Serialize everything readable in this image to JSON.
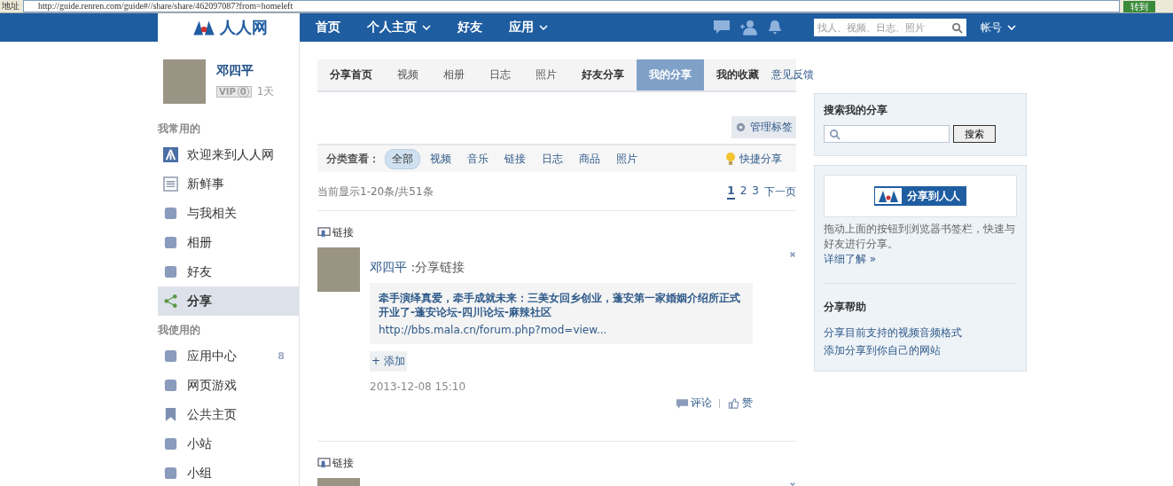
{
  "address_bar": {
    "label": "地址",
    "url": "http://guide.renren.com/guide#//share/share/462097087?from=homeleft",
    "go_label": "转到"
  },
  "nav": {
    "logo_text": "人人网",
    "items": [
      {
        "label": "首页",
        "has_menu": false
      },
      {
        "label": "个人主页",
        "has_menu": true
      },
      {
        "label": "好友",
        "has_menu": false
      },
      {
        "label": "应用",
        "has_menu": true
      }
    ],
    "search_placeholder": "找人、视频、日志、照片",
    "account_label": "帐号"
  },
  "profile": {
    "name": "邓四平",
    "vip": "VIP",
    "vip_level": "0",
    "days": "1天"
  },
  "sidebar": {
    "sections": [
      {
        "title": "我常用的",
        "items": [
          {
            "label": "欢迎来到人人网",
            "selected": false
          },
          {
            "label": "新鲜事",
            "selected": false
          },
          {
            "label": "与我相关",
            "selected": false
          },
          {
            "label": "相册",
            "selected": false
          },
          {
            "label": "好友",
            "selected": false
          },
          {
            "label": "分享",
            "selected": true
          }
        ]
      },
      {
        "title": "我使用的",
        "items": [
          {
            "label": "应用中心",
            "selected": false,
            "badge": "8"
          },
          {
            "label": "网页游戏",
            "selected": false
          },
          {
            "label": "公共主页",
            "selected": false
          },
          {
            "label": "小站",
            "selected": false
          },
          {
            "label": "小组",
            "selected": false
          }
        ]
      }
    ]
  },
  "tabs": [
    {
      "label": "分享首页",
      "bold": true,
      "selected": false
    },
    {
      "label": "视频",
      "bold": false,
      "selected": false
    },
    {
      "label": "相册",
      "bold": false,
      "selected": false
    },
    {
      "label": "日志",
      "bold": false,
      "selected": false
    },
    {
      "label": "照片",
      "bold": false,
      "selected": false
    },
    {
      "label": "好友分享",
      "bold": true,
      "selected": false
    },
    {
      "label": "我的分享",
      "bold": true,
      "selected": true
    },
    {
      "label": "我的收藏",
      "bold": true,
      "selected": false
    }
  ],
  "feedback": "意见反馈",
  "manage_tags": "管理标签",
  "filter": {
    "label": "分类查看：",
    "options": [
      {
        "label": "全部",
        "selected": true
      },
      {
        "label": "视频",
        "selected": false
      },
      {
        "label": "音乐",
        "selected": false
      },
      {
        "label": "链接",
        "selected": false
      },
      {
        "label": "日志",
        "selected": false
      },
      {
        "label": "商品",
        "selected": false
      },
      {
        "label": "照片",
        "selected": false
      }
    ],
    "quick_share": "快捷分享"
  },
  "summary": "当前显示1-20条/共51条",
  "pagination": {
    "pages": [
      {
        "label": "1",
        "selected": true
      },
      {
        "label": "2",
        "selected": false
      },
      {
        "label": "3",
        "selected": false
      }
    ],
    "next": "下一页"
  },
  "posts": [
    {
      "kind": "full",
      "type_label": "链接",
      "author": "邓四平",
      "action": ":分享链接",
      "title": "牵手演绎真爱，牵手成就未来：三美女回乡创业，蓬安第一家婚姻介绍所正式开业了-蓬安论坛-四川论坛-麻辣社区",
      "url": "http://bbs.mala.cn/forum.php?mod=view...",
      "add_label": "+ 添加",
      "time": "2013-12-08 15:10",
      "comment": "评论",
      "like": "赞"
    },
    {
      "kind": "cut",
      "type_label": "链接"
    }
  ],
  "search_box": {
    "title": "搜索我的分享",
    "button": "搜索"
  },
  "share_tool": {
    "button_text": "分享到人人",
    "description": "拖动上面的按钮到浏览器书签栏，快速与好友进行分享。",
    "more_link": "详细了解 »"
  },
  "help": {
    "title": "分享帮助",
    "links": [
      "分享目前支持的视频音频格式",
      "添加分享到你自己的网站"
    ]
  }
}
